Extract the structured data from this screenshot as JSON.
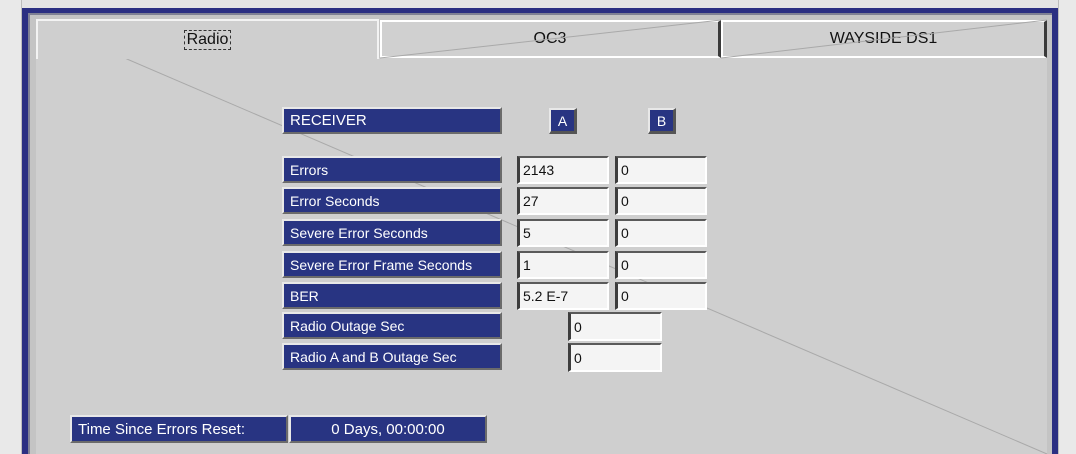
{
  "tabs": [
    {
      "label": "Radio",
      "active": true
    },
    {
      "label": "OC3",
      "active": false
    },
    {
      "label": "WAYSIDE DS1",
      "active": false
    }
  ],
  "receiver": {
    "header": "RECEIVER",
    "col_a": "A",
    "col_b": "B"
  },
  "rows": [
    {
      "label": "Errors",
      "a": "2143",
      "b": "0"
    },
    {
      "label": "Error Seconds",
      "a": "27",
      "b": "0"
    },
    {
      "label": "Severe Error Seconds",
      "a": "5",
      "b": "0"
    },
    {
      "label": "Severe Error Frame Seconds",
      "a": "1",
      "b": "0"
    },
    {
      "label": "BER",
      "a": "5.2 E-7",
      "b": "0"
    }
  ],
  "outage": [
    {
      "label": "Radio Outage Sec",
      "value": "0"
    },
    {
      "label": "Radio A and B Outage Sec",
      "value": "0"
    }
  ],
  "reset": {
    "label": "Time Since Errors Reset:",
    "value": "0 Days, 00:00:00"
  },
  "colors": {
    "navy": "#283482",
    "frame": "#2b2f82",
    "panel": "#cfcfcf"
  }
}
